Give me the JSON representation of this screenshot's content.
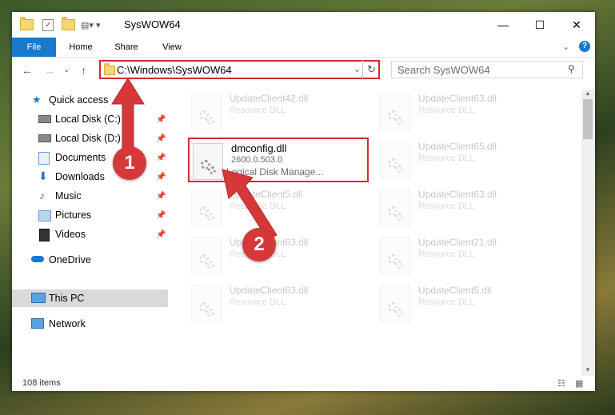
{
  "window": {
    "title": "SysWOW64"
  },
  "ribbon": {
    "tabs": [
      "File",
      "Home",
      "Share",
      "View"
    ]
  },
  "address": {
    "path": "C:\\Windows\\SysWOW64",
    "search_placeholder": "Search SysWOW64"
  },
  "sidebar": {
    "items": [
      {
        "label": "Quick access"
      },
      {
        "label": "Local Disk (C:)"
      },
      {
        "label": "Local Disk (D:)"
      },
      {
        "label": "Documents"
      },
      {
        "label": "Downloads"
      },
      {
        "label": "Music"
      },
      {
        "label": "Pictures"
      },
      {
        "label": "Videos"
      },
      {
        "label": "OneDrive"
      },
      {
        "label": "This PC"
      },
      {
        "label": "Network"
      }
    ]
  },
  "files": [
    {
      "name": "UpdateClient42.dll",
      "desc": "Resource DLL"
    },
    {
      "name": "UpdateClient63.dll",
      "desc": "Resource DLL"
    },
    {
      "name": "UpdateClient65.dll",
      "desc": "Resource DLL"
    },
    {
      "name": "UpdateClient5.dll",
      "desc": "Resource DLL"
    },
    {
      "name": "UpdateClient63.dll",
      "desc": "Resource DLL"
    },
    {
      "name": "UpdateClient63.dll",
      "desc": "Resource DLL"
    },
    {
      "name": "UpdateClient21.dll",
      "desc": "Resource DLL"
    },
    {
      "name": "UpdateClient63.dll",
      "desc": "Resource DLL"
    },
    {
      "name": "UpdateClient5.dll",
      "desc": "Resource DLL"
    }
  ],
  "highlighted_file": {
    "name": "dmconfig.dll",
    "version": "2600.0.503.0",
    "desc": "Logical Disk Manage..."
  },
  "status": {
    "items": "108 items"
  },
  "badges": {
    "one": "1",
    "two": "2"
  },
  "colors": {
    "accent": "#1979ca",
    "highlight": "#d32a2a",
    "badge": "#d6383a"
  }
}
